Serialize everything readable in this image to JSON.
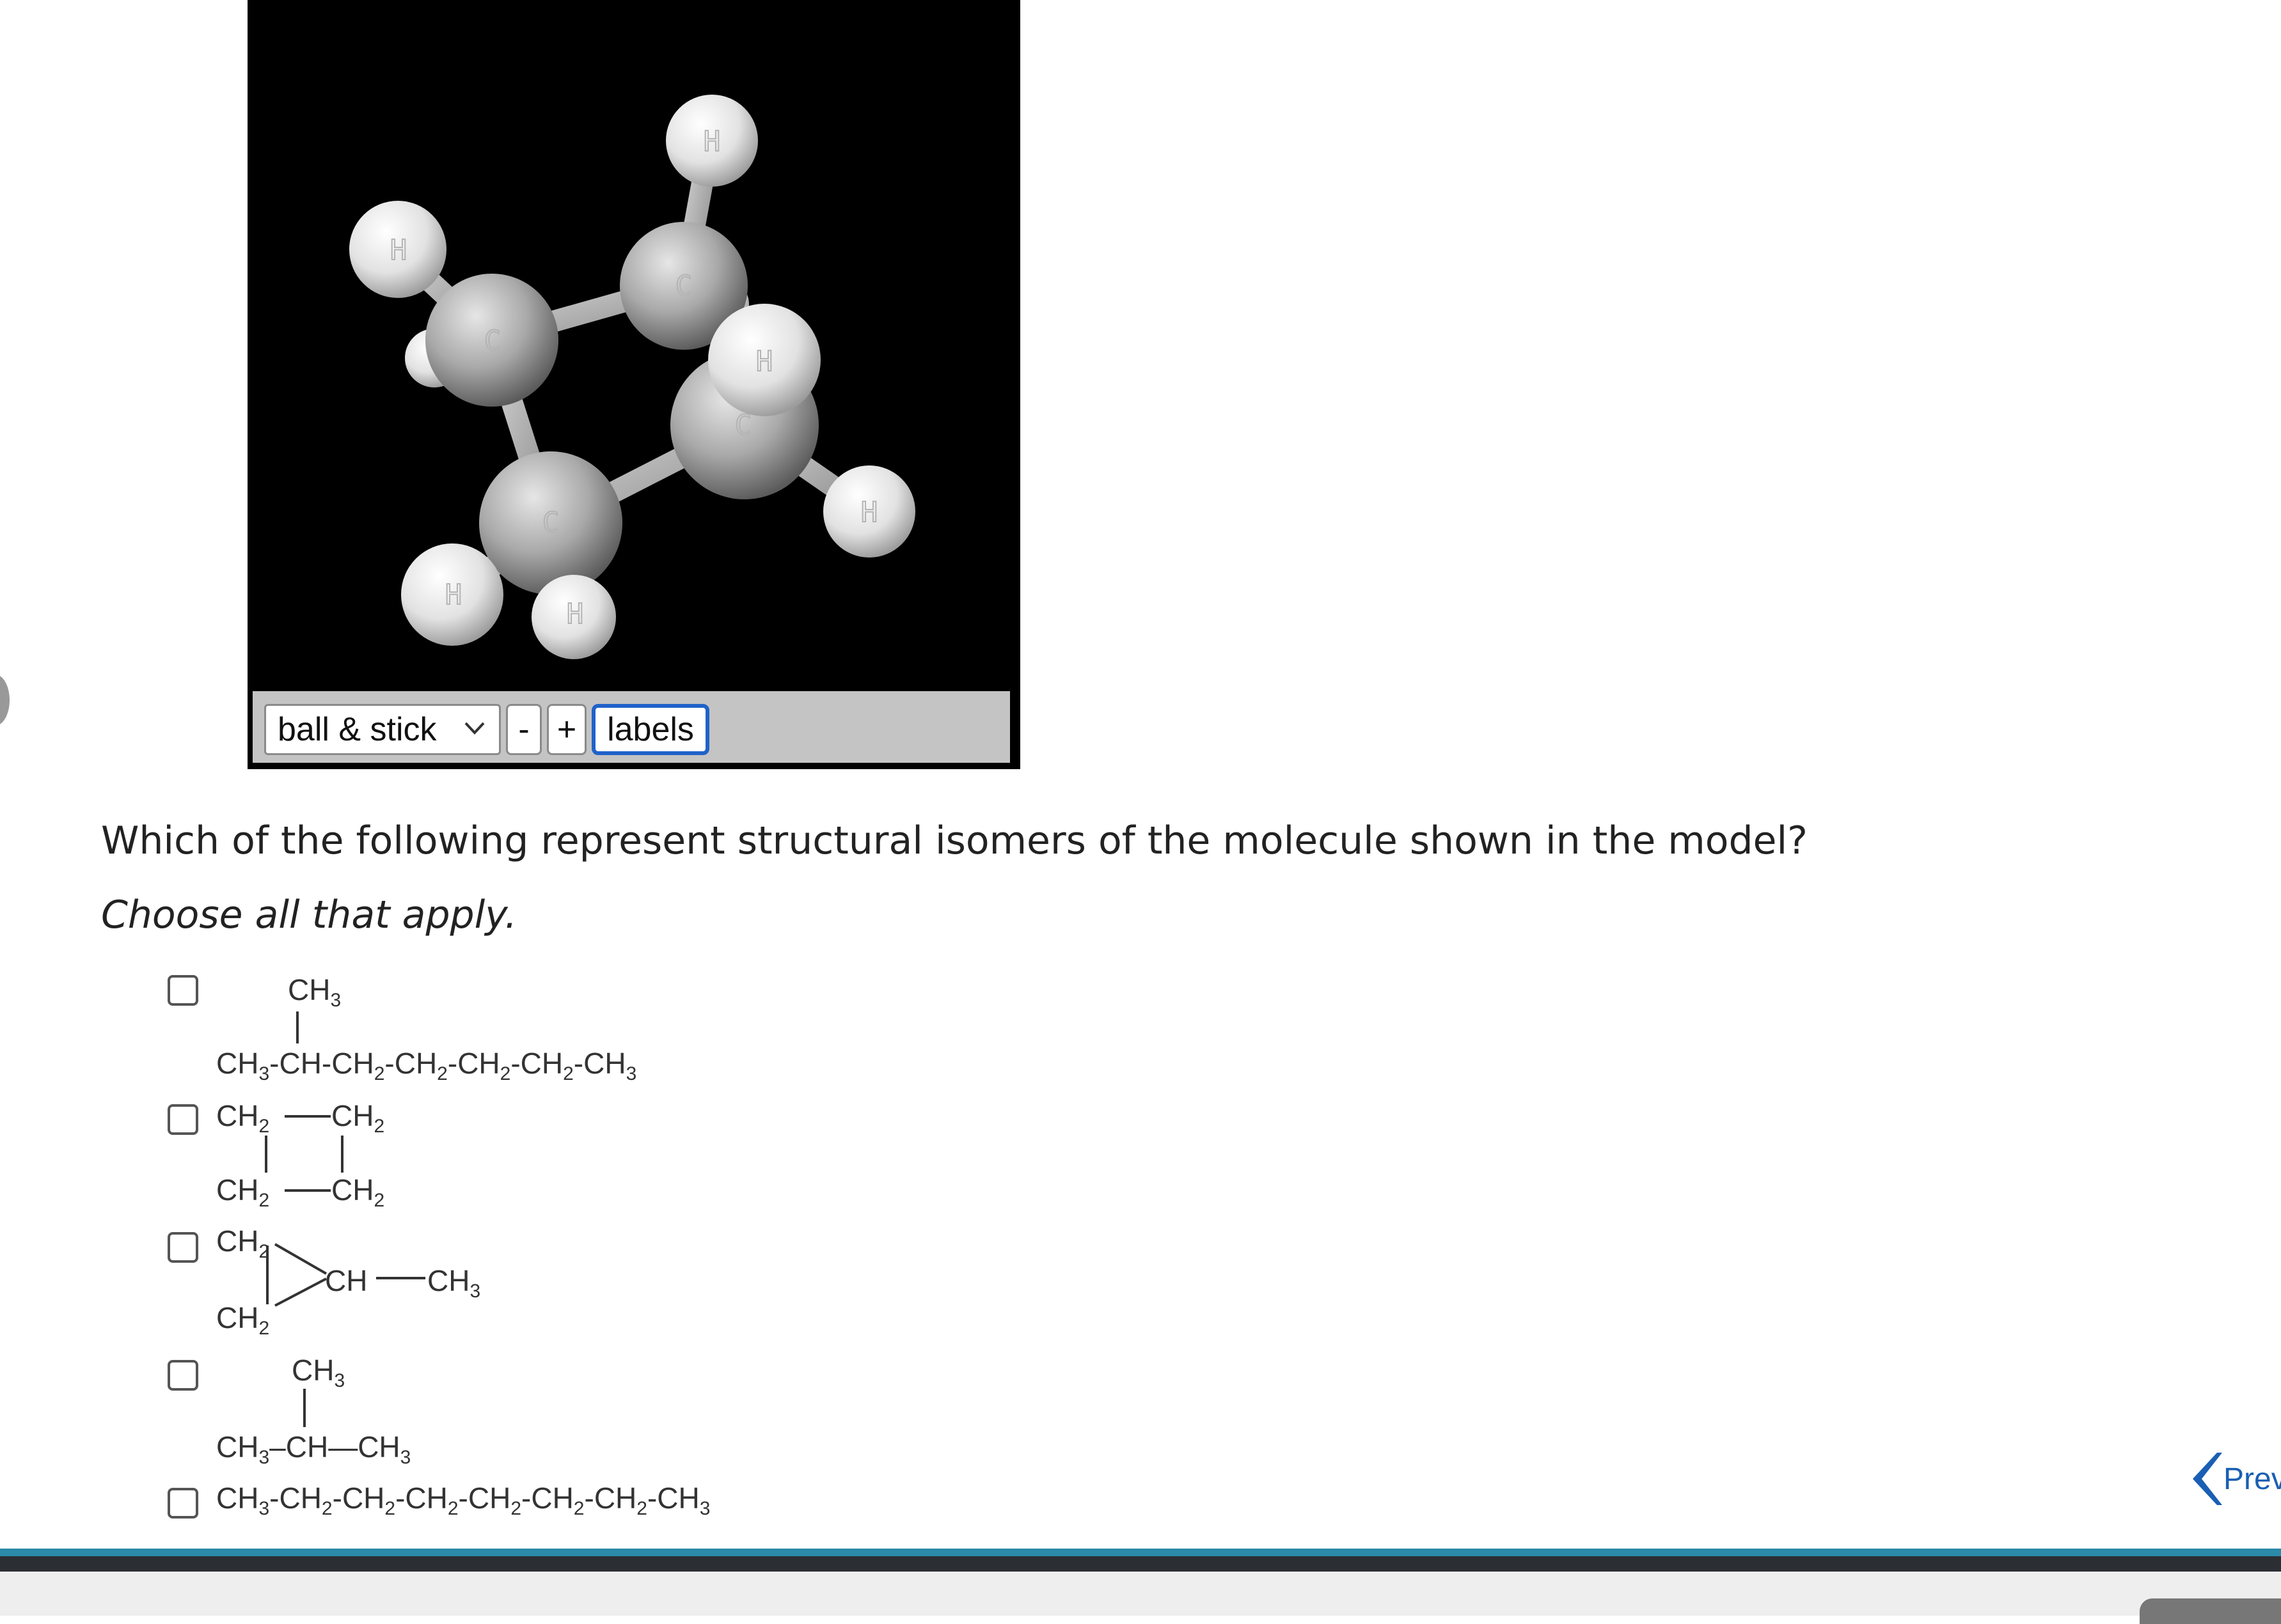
{
  "viewer": {
    "render_mode": "ball & stick",
    "zoom_out_label": "-",
    "zoom_in_label": "+",
    "labels_button": "labels",
    "atom_labels": {
      "carbon": "C",
      "hydrogen": "H"
    }
  },
  "question": {
    "text": "Which of the following represent structural isomers of the molecule shown in the model?",
    "instruction": "Choose all that apply."
  },
  "options": [
    {
      "checked": false,
      "top_group": "CH3",
      "chain": [
        "CH3",
        "CH",
        "CH2",
        "CH2",
        "CH2",
        "CH2",
        "CH3"
      ]
    },
    {
      "checked": false,
      "ring": [
        "CH2",
        "CH2",
        "CH2",
        "CH2"
      ]
    },
    {
      "checked": false,
      "ring_groups": [
        "CH2",
        "CH2",
        "CH"
      ],
      "substituent": "CH3"
    },
    {
      "checked": false,
      "top_group": "CH3",
      "chain": [
        "CH3",
        "CH",
        "CH3"
      ]
    },
    {
      "checked": false,
      "chain": [
        "CH3",
        "CH2",
        "CH2",
        "CH2",
        "CH2",
        "CH2",
        "CH2",
        "CH3"
      ]
    }
  ],
  "nav": {
    "prev_label": "Prev"
  },
  "colors": {
    "accent": "#1f62c9",
    "link": "#1a5fb4",
    "footer_teal": "#2a8aa8"
  },
  "icons": [
    "chevron-down-icon",
    "chevron-left-icon"
  ]
}
